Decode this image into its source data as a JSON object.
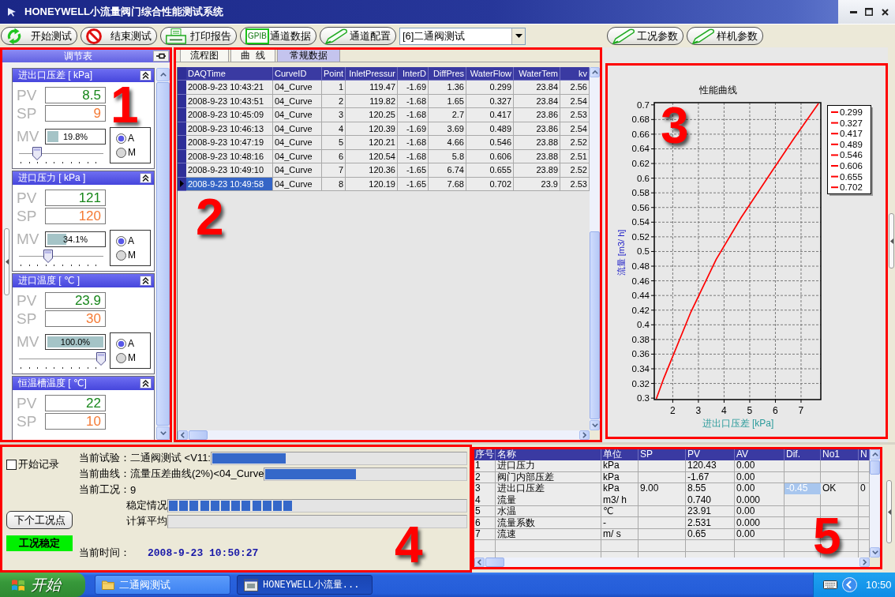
{
  "window": {
    "title": "HONEYWELL小流量阀门综合性能测试系统"
  },
  "toolbar": {
    "buttons": [
      {
        "kind": "cycle",
        "label": "开始测试"
      },
      {
        "kind": "stop",
        "label": "结束测试"
      },
      {
        "kind": "printer",
        "label": "打印报告"
      },
      {
        "kind": "gpib",
        "icon_text": "GPIB",
        "label": "通道数据"
      },
      {
        "kind": "pen",
        "label": "通道配置"
      }
    ],
    "test_select": {
      "value": "[6]二通阀测试"
    },
    "extra_buttons": [
      {
        "kind": "pen",
        "label": "工况参数"
      },
      {
        "kind": "pen",
        "label": "样机参数"
      }
    ]
  },
  "controller_panel": {
    "annotation": "1",
    "title": "调节表",
    "cards": [
      {
        "title": "进出口压差 [ kPa]",
        "pv": {
          "label": "PV",
          "value": "8.5"
        },
        "sp": {
          "label": "SP",
          "value": "9"
        },
        "mv": {
          "label": "MV",
          "reading": "19.8%",
          "level": 0.198
        },
        "slider": {
          "level": 0.2
        },
        "modes": [
          {
            "label": "A",
            "selected": true
          },
          {
            "label": "M",
            "selected": false
          }
        ]
      },
      {
        "title": "进口压力 [ kPa ]",
        "pv": {
          "label": "PV",
          "value": "121"
        },
        "sp": {
          "label": "SP",
          "value": "120"
        },
        "mv": {
          "label": "MV",
          "reading": "34.1%",
          "level": 0.341
        },
        "slider": {
          "level": 0.34
        },
        "modes": [
          {
            "label": "A",
            "selected": true
          },
          {
            "label": "M",
            "selected": false
          }
        ]
      },
      {
        "title": "进口温度 [ ℃ ]",
        "pv": {
          "label": "PV",
          "value": "23.9"
        },
        "sp": {
          "label": "SP",
          "value": "30"
        },
        "mv": {
          "label": "MV",
          "reading": "100.0%",
          "level": 1
        },
        "slider": {
          "level": 1
        },
        "modes": [
          {
            "label": "A",
            "selected": true
          },
          {
            "label": "M",
            "selected": false
          }
        ]
      },
      {
        "title": "恒温槽温度 [ ℃]",
        "pv": {
          "label": "PV",
          "value": "22"
        },
        "sp": {
          "label": "SP",
          "value": "10"
        }
      }
    ]
  },
  "data_panel": {
    "annotation": "2",
    "tabs": [
      {
        "label": "流程图",
        "selected": false
      },
      {
        "label": "曲  线",
        "selected": false
      },
      {
        "label": "常规数据",
        "selected": true
      }
    ],
    "table": {
      "columns": [
        {
          "label": "DAQTime",
          "focused": true
        },
        {
          "label": "CurveID",
          "focused": false
        },
        {
          "label": "Point",
          "focused": false
        },
        {
          "label": "InletPressur",
          "focused": false
        },
        {
          "label": "InterD",
          "focused": false
        },
        {
          "label": "DiffPres",
          "focused": false
        },
        {
          "label": "WaterFlow",
          "focused": false
        },
        {
          "label": "WaterTem",
          "focused": false
        },
        {
          "label": "kv",
          "focused": false
        }
      ],
      "rows": [
        {
          "selected": false,
          "cells": [
            "2008-9-23 10:43:21",
            "04_Curve",
            "1",
            "119.47",
            "-1.69",
            "1.36",
            "0.299",
            "23.84",
            "2.56"
          ]
        },
        {
          "selected": false,
          "cells": [
            "2008-9-23 10:43:51",
            "04_Curve",
            "2",
            "119.82",
            "-1.68",
            "1.65",
            "0.327",
            "23.84",
            "2.54"
          ]
        },
        {
          "selected": false,
          "cells": [
            "2008-9-23 10:45:09",
            "04_Curve",
            "3",
            "120.25",
            "-1.68",
            "2.7",
            "0.417",
            "23.86",
            "2.53"
          ]
        },
        {
          "selected": false,
          "cells": [
            "2008-9-23 10:46:13",
            "04_Curve",
            "4",
            "120.39",
            "-1.69",
            "3.69",
            "0.489",
            "23.86",
            "2.54"
          ]
        },
        {
          "selected": false,
          "cells": [
            "2008-9-23 10:47:19",
            "04_Curve",
            "5",
            "120.21",
            "-1.68",
            "4.66",
            "0.546",
            "23.88",
            "2.52"
          ]
        },
        {
          "selected": false,
          "cells": [
            "2008-9-23 10:48:16",
            "04_Curve",
            "6",
            "120.54",
            "-1.68",
            "5.8",
            "0.606",
            "23.88",
            "2.51"
          ]
        },
        {
          "selected": false,
          "cells": [
            "2008-9-23 10:49:10",
            "04_Curve",
            "7",
            "120.36",
            "-1.65",
            "6.74",
            "0.655",
            "23.89",
            "2.52"
          ]
        },
        {
          "selected": true,
          "cells": [
            "2008-9-23 10:49:58",
            "04_Curve",
            "8",
            "120.19",
            "-1.65",
            "7.68",
            "0.702",
            "23.9",
            "2.53"
          ]
        }
      ]
    }
  },
  "chart_panel": {
    "annotation": "3",
    "chart_data": {
      "type": "line",
      "title": "性能曲线",
      "xlabel": "进出口压差 [kPa]",
      "ylabel": "流量 [m3/ h]",
      "x": [
        1.36,
        1.65,
        2.7,
        3.69,
        4.66,
        5.8,
        6.74,
        7.68
      ],
      "series": [
        {
          "color": "#ff0000",
          "values": [
            0.299,
            0.327,
            0.417,
            0.489,
            0.546,
            0.606,
            0.655,
            0.702
          ]
        }
      ],
      "xlim": [
        1.28,
        7.77
      ],
      "ylim": [
        0.298,
        0.703
      ],
      "xticks": [
        2,
        3,
        4,
        5,
        6,
        7
      ],
      "yticks": [
        0.3,
        0.32,
        0.34,
        0.36,
        0.38,
        0.4,
        0.42,
        0.44,
        0.46,
        0.48,
        0.5,
        0.52,
        0.54,
        0.56,
        0.58,
        0.6,
        0.62,
        0.64,
        0.66,
        0.68,
        0.7
      ],
      "grid": true
    },
    "legend": [
      "0.299",
      "0.327",
      "0.417",
      "0.489",
      "0.546",
      "0.606",
      "0.655",
      "0.702"
    ]
  },
  "status_panel": {
    "annotation": "4",
    "record": {
      "label": "开始记录",
      "checked": false
    },
    "next_button": "下个工况点",
    "condition": {
      "label": "工况稳定",
      "stable": true
    },
    "fields": [
      {
        "kind": "bar",
        "label": "当前试验：",
        "value": "二通阀测试 <V11:",
        "level": 0.29
      },
      {
        "kind": "bar",
        "label": "当前曲线：",
        "value": "流量压差曲线(2%)<04_Curve",
        "level": 0.45
      },
      {
        "kind": "text",
        "label": "当前工况：",
        "value": "9"
      },
      {
        "kind": "blocks",
        "label": "稳定情况",
        "level": 0.42
      },
      {
        "kind": "blocks",
        "label": "计算平均",
        "level": 0
      },
      {
        "kind": "time",
        "label": "当前时间：",
        "value": "2008-9-23 10:50:27"
      }
    ]
  },
  "channel_panel": {
    "annotation": "5",
    "table": {
      "columns": [
        {
          "label": "序号",
          "focused": false
        },
        {
          "label": "名称",
          "focused": false
        },
        {
          "label": "单位",
          "focused": false
        },
        {
          "label": "SP",
          "focused": false
        },
        {
          "label": "PV",
          "focused": false
        },
        {
          "label": "AV",
          "focused": false
        },
        {
          "label": "Dif.",
          "focused": true
        },
        {
          "label": "No1",
          "focused": false
        },
        {
          "label": "N",
          "focused": false
        }
      ],
      "rows": [
        {
          "selected": false,
          "cells": [
            "1",
            "进口压力",
            "kPa",
            null,
            "120.43",
            "0.00",
            null,
            null,
            null
          ]
        },
        {
          "selected": false,
          "cells": [
            "2",
            "阀门内部压差",
            "kPa",
            null,
            "-1.67",
            "0.00",
            null,
            null,
            null
          ]
        },
        {
          "selected": true,
          "cells": [
            "3",
            "进出口压差",
            "kPa",
            "9.00",
            "8.55",
            "0.00",
            "-0.45",
            "OK",
            "0"
          ]
        },
        {
          "selected": false,
          "cells": [
            "4",
            "流量",
            "m3/ h",
            null,
            "0.740",
            "0.000",
            null,
            null,
            null
          ]
        },
        {
          "selected": false,
          "cells": [
            "5",
            "水温",
            "℃",
            null,
            "23.91",
            "0.00",
            null,
            null,
            null
          ]
        },
        {
          "selected": false,
          "cells": [
            "6",
            "流量系数",
            "-",
            null,
            "2.531",
            "0.000",
            null,
            null,
            null
          ]
        },
        {
          "selected": false,
          "cells": [
            "7",
            "流速",
            "m/ s",
            null,
            "0.65",
            "0.00",
            null,
            null,
            null
          ]
        }
      ]
    }
  },
  "taskbar": {
    "start": "开始",
    "items": [
      {
        "kind": "folder",
        "label": "二通阀测试",
        "selected": false
      },
      {
        "kind": "app",
        "label": "HONEYWELL小流量...",
        "selected": true
      }
    ],
    "clock": "10:50"
  }
}
